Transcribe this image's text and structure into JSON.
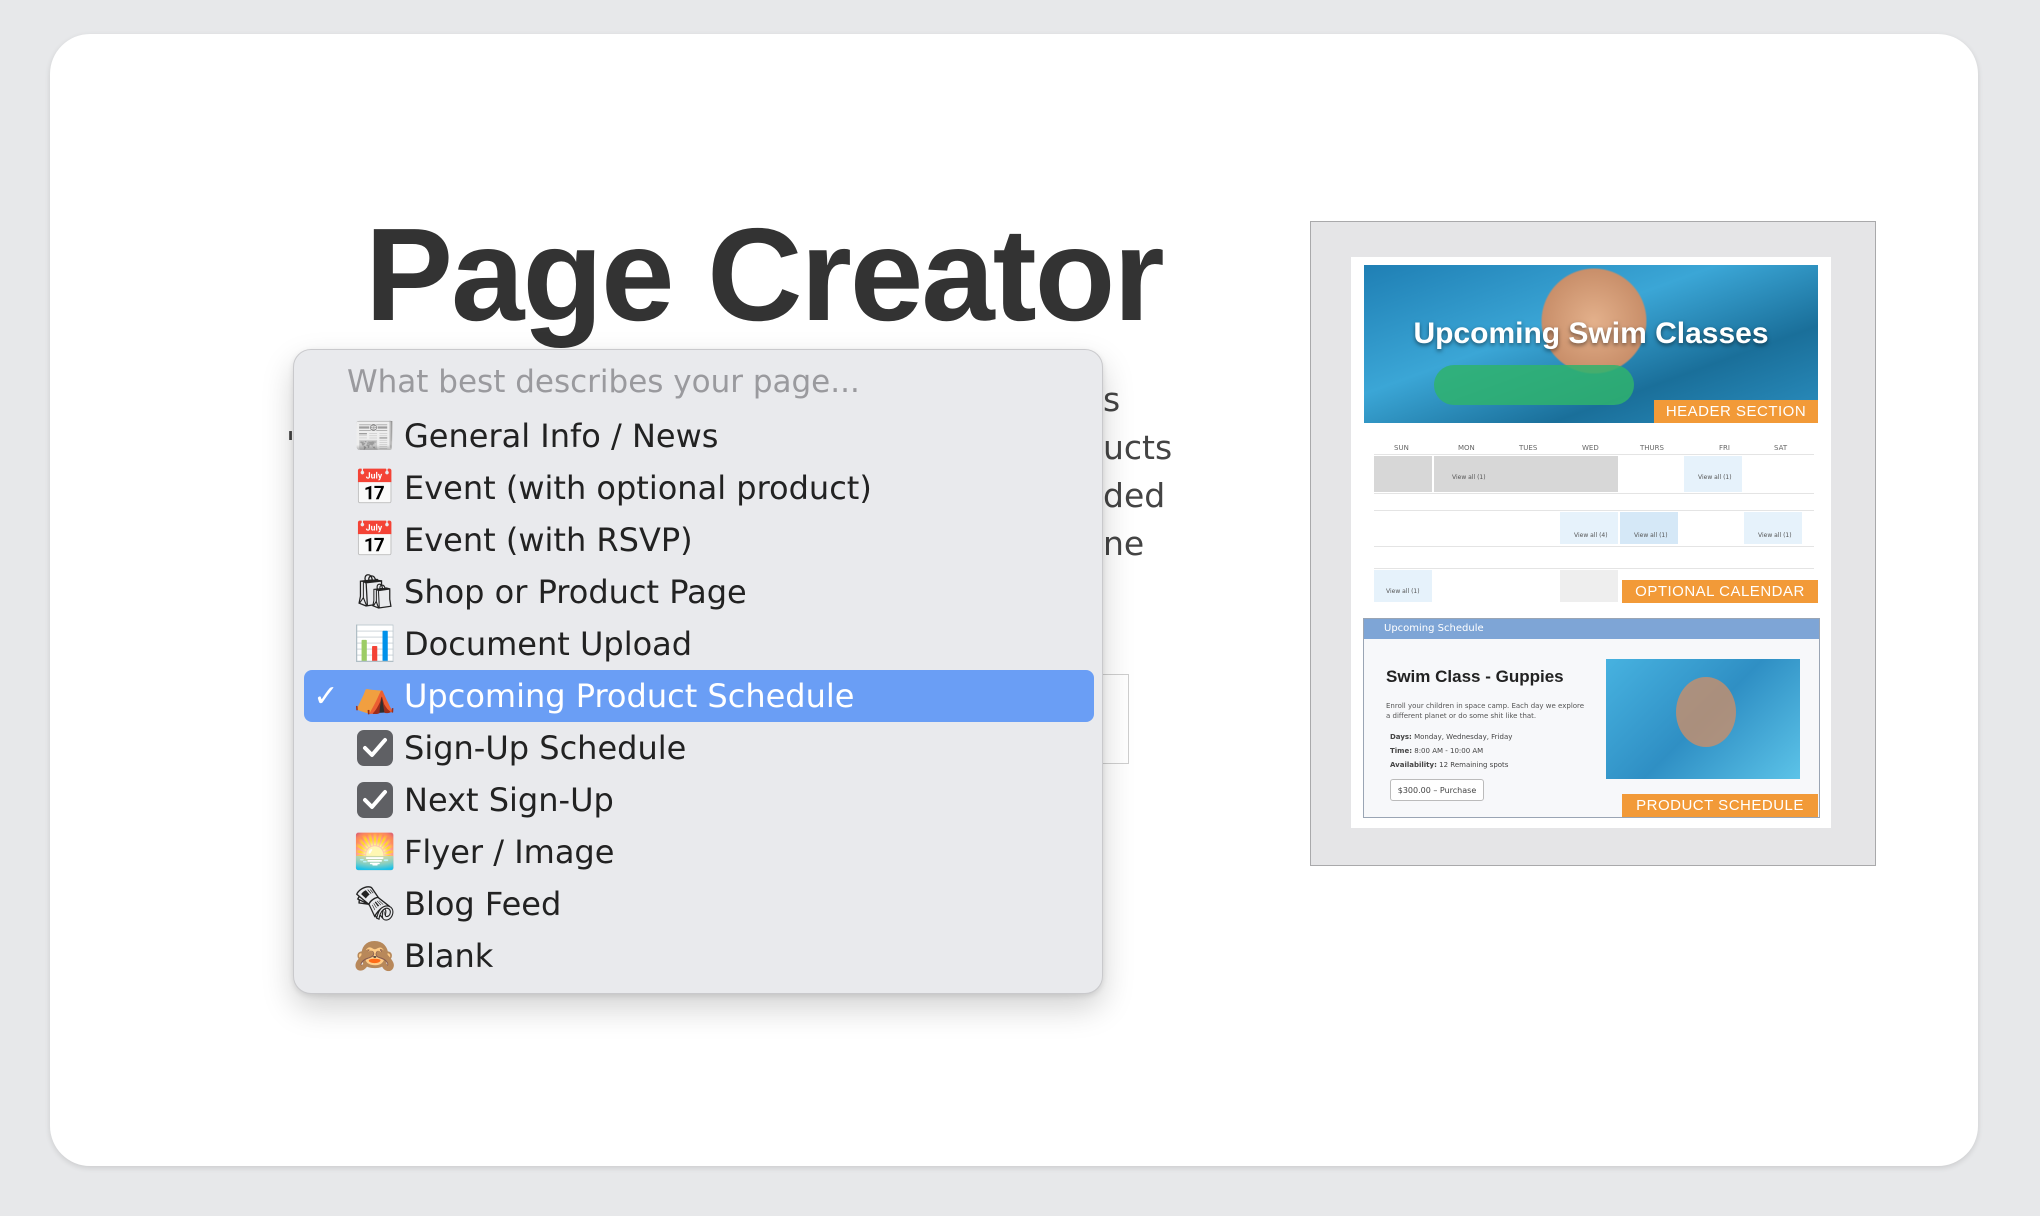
{
  "page": {
    "title": "Page Creator",
    "description_fragments": [
      "s",
      "ucts",
      "ded",
      "ne"
    ],
    "leading_char": "'"
  },
  "dropdown": {
    "placeholder": "What best describes your page...",
    "selected_index": 5,
    "items": [
      {
        "icon": "newspaper-icon",
        "glyph": "📰",
        "label": "General Info / News"
      },
      {
        "icon": "calendar-icon",
        "glyph": "📅",
        "label": "Event (with optional product)"
      },
      {
        "icon": "calendar-icon",
        "glyph": "📅",
        "label": "Event (with RSVP)"
      },
      {
        "icon": "shopping-bags-icon",
        "glyph": "🛍",
        "label": "Shop or Product Page"
      },
      {
        "icon": "bar-chart-icon",
        "glyph": "📊",
        "label": "Document Upload"
      },
      {
        "icon": "tent-icon",
        "glyph": "⛺",
        "label": "Upcoming Product Schedule"
      },
      {
        "icon": "checkbox-icon",
        "glyph": "✔",
        "label": "Sign-Up Schedule"
      },
      {
        "icon": "checkbox-icon",
        "glyph": "✔",
        "label": "Next Sign-Up"
      },
      {
        "icon": "sunrise-icon",
        "glyph": "🌅",
        "label": "Flyer / Image"
      },
      {
        "icon": "rolled-newspaper-icon",
        "glyph": "🗞",
        "label": "Blog Feed"
      },
      {
        "icon": "monkey-icon",
        "glyph": "🙈",
        "label": "Blank"
      }
    ],
    "check_glyph": "✓"
  },
  "preview": {
    "hero_title": "Upcoming Swim Classes",
    "header_tag": "HEADER SECTION",
    "calendar_tag": "OPTIONAL CALENDAR",
    "schedule_tag": "PRODUCT SCHEDULE",
    "weekdays": [
      "SUN",
      "MON",
      "TUES",
      "WED",
      "THURS",
      "FRI",
      "SAT"
    ],
    "view_all_1": "View all (1)",
    "view_all_4": "View all (4)",
    "schedule_bar": "Upcoming Schedule",
    "schedule_title": "Swim Class - Guppies",
    "schedule_body": "Enroll your children in space camp. Each day we explore a different planet or do some shit like that.",
    "days_label": "Days:",
    "days_value": "Monday, Wednesday, Friday",
    "time_label": "Time:",
    "time_value": "8:00 AM - 10:00 AM",
    "avail_label": "Availability:",
    "avail_value": "12 Remaining spots",
    "purchase_button": "$300.00 – Purchase"
  },
  "colors": {
    "selected": "#6a9ef5",
    "tag_orange": "#f29a38",
    "schedule_bar": "#7ea5d6"
  }
}
